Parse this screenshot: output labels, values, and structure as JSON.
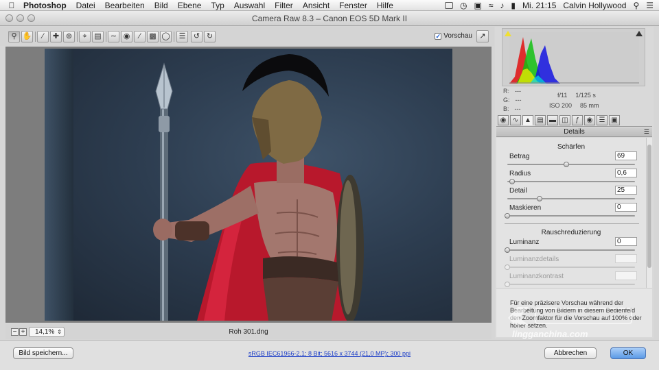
{
  "menubar": {
    "app_name": "Photoshop",
    "items": [
      "Datei",
      "Bearbeiten",
      "Bild",
      "Ebene",
      "Typ",
      "Auswahl",
      "Filter",
      "Ansicht",
      "Fenster",
      "Hilfe"
    ],
    "clock": "Mi. 21:15",
    "user": "Calvin Hollywood"
  },
  "window": {
    "title": "Camera Raw 8.3  –  Canon EOS 5D Mark II"
  },
  "toolbar": {
    "tools": [
      "zoom-icon",
      "hand-icon",
      "white-balance-icon",
      "color-sampler-icon",
      "target-adjust-icon",
      "crop-icon",
      "straighten-icon",
      "spot-removal-icon",
      "red-eye-icon",
      "adjustment-brush-icon",
      "graduated-filter-icon",
      "radial-filter-icon",
      "preferences-icon",
      "rotate-left-icon",
      "rotate-right-icon"
    ],
    "preview_label": "Vorschau",
    "preview_checked": true
  },
  "status": {
    "zoom": "14,1%",
    "filename": "Roh 301.dng"
  },
  "histogram": {
    "rgb_labels": [
      "R:",
      "G:",
      "B:"
    ],
    "rgb_values": [
      "---",
      "---",
      "---"
    ],
    "aperture": "f/11",
    "shutter": "1/125 s",
    "iso": "ISO 200",
    "focal": "85 mm"
  },
  "panel": {
    "tabs": [
      "basic-icon",
      "tone-curve-icon",
      "detail-icon",
      "hsl-icon",
      "split-toning-icon",
      "lens-icon",
      "fx-icon",
      "camera-calibration-icon",
      "presets-icon",
      "snapshots-icon"
    ],
    "active_tab": 2,
    "title": "Details",
    "sharpening": {
      "title": "Schärfen",
      "sliders": [
        {
          "label": "Betrag",
          "value": "69",
          "pos": 0.46
        },
        {
          "label": "Radius",
          "value": "0,6",
          "pos": 0.04
        },
        {
          "label": "Detail",
          "value": "25",
          "pos": 0.25
        },
        {
          "label": "Maskieren",
          "value": "0",
          "pos": 0.0
        }
      ]
    },
    "noise": {
      "title": "Rauschreduzierung",
      "sliders": [
        {
          "label": "Luminanz",
          "value": "0",
          "pos": 0.0,
          "disabled": false
        },
        {
          "label": "Luminanzdetails",
          "value": "",
          "pos": 0.0,
          "disabled": true
        },
        {
          "label": "Luminanzkontrast",
          "value": "",
          "pos": 0.0,
          "disabled": true
        }
      ]
    },
    "hint": "Für eine präzisere Vorschau während der Bearbeitung von Bildern in diesem Bedienfeld den Zoomfaktor für die Vorschau auf 100% oder höher setzen."
  },
  "bottom": {
    "save_label": "Bild speichern...",
    "workflow": "sRGB IEC61966-2.1; 8 Bit; 5616 x 3744 (21,0 MP); 300 ppi",
    "cancel_label": "Abbrechen",
    "ok_label": "OK"
  },
  "watermark": {
    "url": "lingganchina.com"
  }
}
